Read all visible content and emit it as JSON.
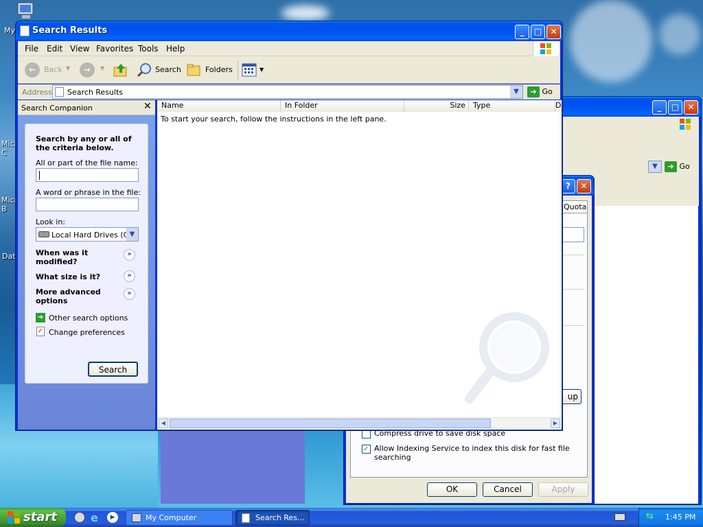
{
  "desktop": {
    "icons": [
      "My",
      "Micro C",
      "Micro B",
      "Data"
    ]
  },
  "main_window": {
    "title": "Search Results",
    "menu": [
      "File",
      "Edit",
      "View",
      "Favorites",
      "Tools",
      "Help"
    ],
    "toolbar": {
      "back_label": "Back",
      "search_label": "Search",
      "folders_label": "Folders"
    },
    "address": {
      "label": "Address",
      "value": "Search Results",
      "go_label": "Go"
    },
    "companion": {
      "title": "Search Companion",
      "heading": "Search by any or all of the criteria below.",
      "filename_label": "All or part of the file name:",
      "filename_value": "",
      "phrase_label": "A word or phrase in the file:",
      "phrase_value": "",
      "lookin_label": "Look in:",
      "lookin_value": "Local Hard Drives (C:)",
      "modified_label": "When was it modified?",
      "size_label": "What size is it?",
      "advanced_label": "More advanced options",
      "other_options_label": "Other search options",
      "preferences_label": "Change preferences",
      "search_button": "Search"
    },
    "results": {
      "columns": [
        "Name",
        "In Folder",
        "Size",
        "Type",
        "D"
      ],
      "message": "To start your search, follow the instructions in the left pane."
    }
  },
  "background_window": {
    "go_label": "Go"
  },
  "properties_dialog": {
    "tab_label": "Quota",
    "button_partial": "up",
    "compress_label": "Compress drive to save disk space",
    "indexing_label": "Allow Indexing Service to index this disk for fast file searching",
    "indexing_checked": true,
    "ok_label": "OK",
    "cancel_label": "Cancel",
    "apply_label": "Apply"
  },
  "taskbar": {
    "start_label": "start",
    "tasks": [
      {
        "label": "My Computer"
      },
      {
        "label": "Search Res..."
      }
    ],
    "clock": "1:45 PM"
  }
}
